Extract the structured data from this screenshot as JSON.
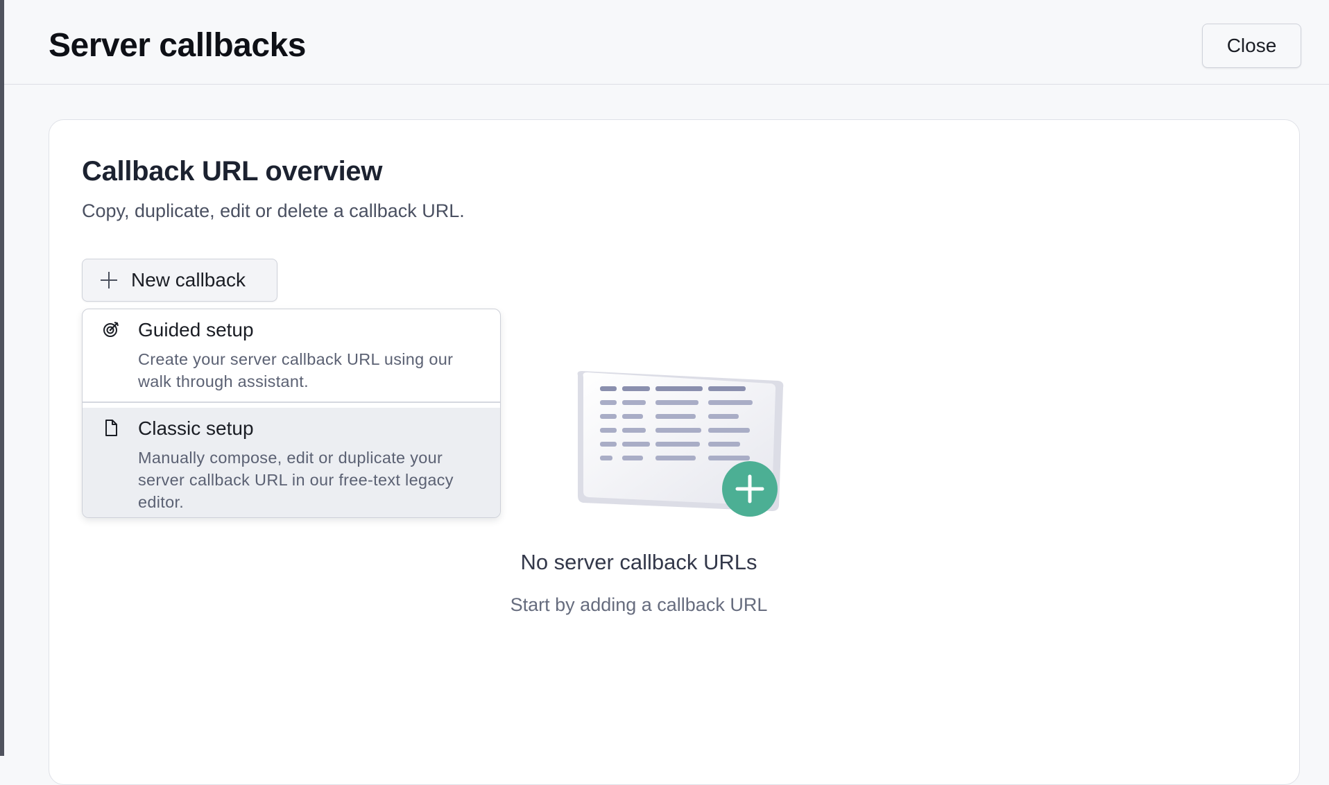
{
  "header": {
    "title": "Server callbacks",
    "close_label": "Close"
  },
  "card": {
    "title": "Callback URL overview",
    "subtitle": "Copy, duplicate, edit or delete a callback URL.",
    "new_button_label": "New callback"
  },
  "menu": {
    "items": [
      {
        "icon": "target-icon",
        "title": "Guided setup",
        "description": "Create your server callback URL using our walk through assistant."
      },
      {
        "icon": "document-icon",
        "title": "Classic setup",
        "description": "Manually compose, edit or duplicate your server callback URL in our free-text legacy editor."
      }
    ],
    "highlighted_item": "Classic setup"
  },
  "empty_state": {
    "title": "No server callback URLs",
    "subtitle": "Start by adding a callback URL"
  },
  "colors": {
    "accent_green": "#4caf94",
    "illustration_lines": "#a9adc6",
    "illustration_header": "#8a8fae"
  }
}
